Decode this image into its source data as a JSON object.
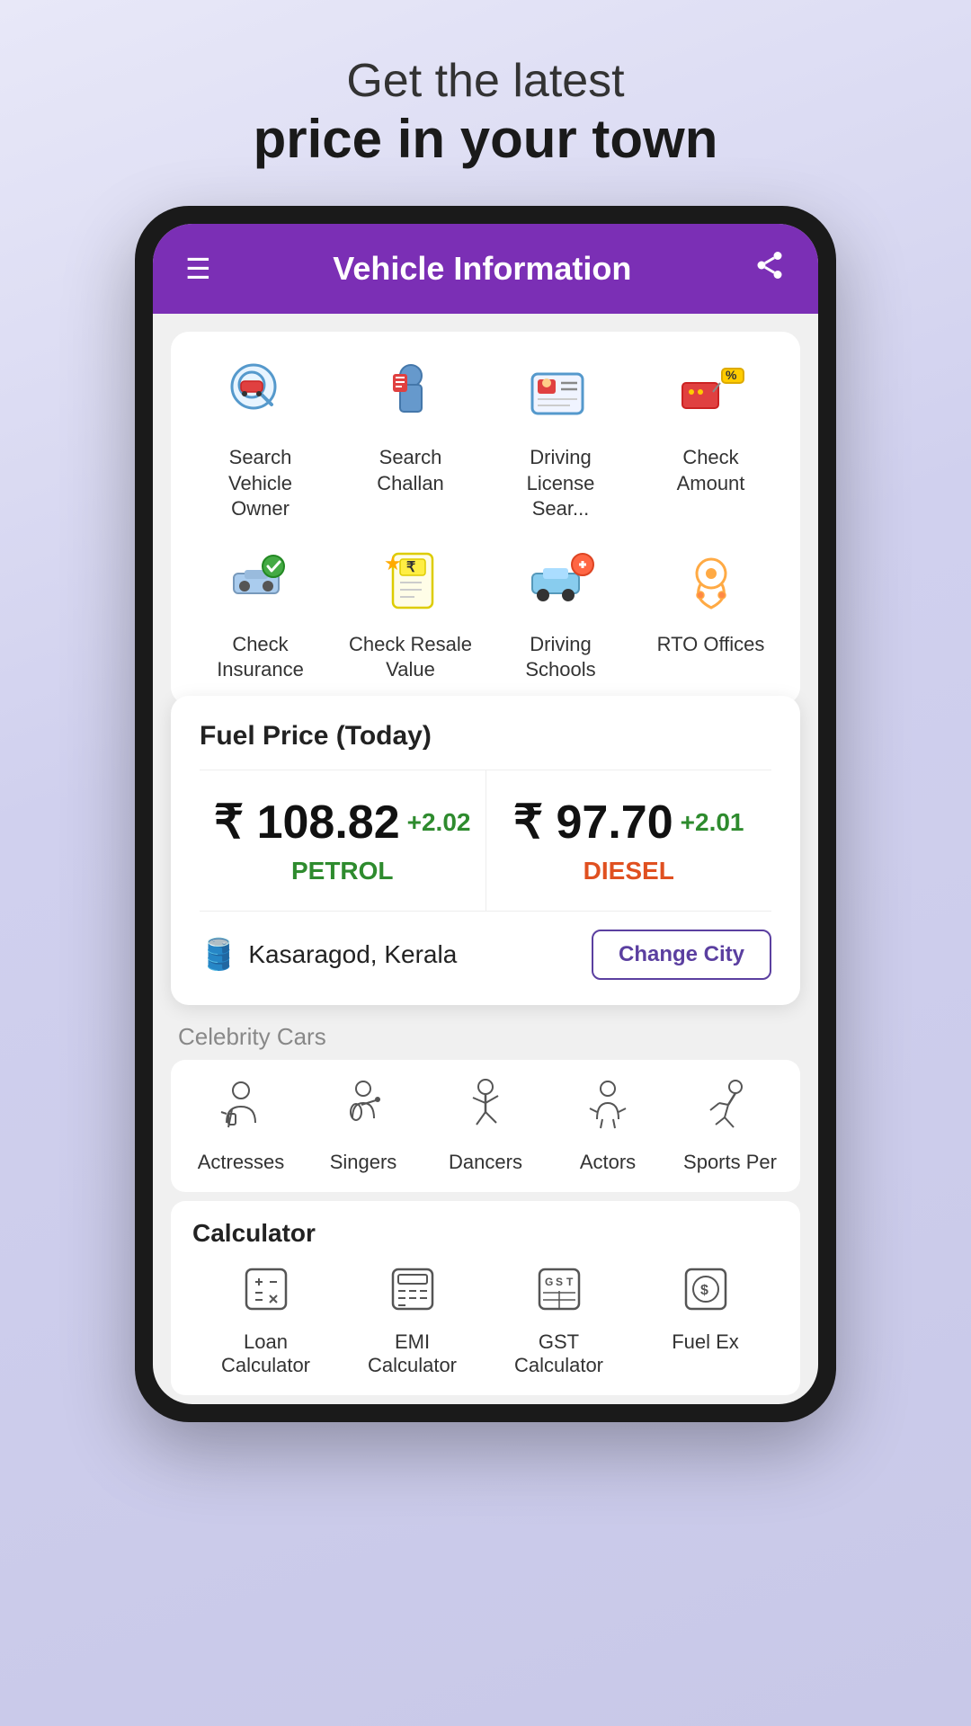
{
  "headline": {
    "line1": "Get the latest",
    "line2": "price in your town"
  },
  "app": {
    "header_title": "Vehicle Information",
    "menu_icon": "☰",
    "share_icon": "⬆"
  },
  "grid": {
    "row1": [
      {
        "id": "search-vehicle-owner",
        "label": "Search Vehicle Owner",
        "icon": "🔍"
      },
      {
        "id": "search-challan",
        "label": "Search Challan",
        "icon": "👮"
      },
      {
        "id": "driving-license",
        "label": "Driving License Sear...",
        "icon": "🪪"
      },
      {
        "id": "check-amount",
        "label": "Check Amount",
        "icon": "🏷️"
      }
    ],
    "row2": [
      {
        "id": "check-insurance",
        "label": "Check Insurance",
        "icon": "🚗"
      },
      {
        "id": "check-resale",
        "label": "Check Resale Value",
        "icon": "🏷️"
      },
      {
        "id": "driving-schools",
        "label": "Driving Schools",
        "icon": "🚙"
      },
      {
        "id": "rto-offices",
        "label": "RTO Offices",
        "icon": "📍"
      }
    ]
  },
  "fuel": {
    "title": "Fuel Price (Today)",
    "petrol": {
      "value": "₹ 108.82",
      "change": "+2.02",
      "label": "PETROL"
    },
    "diesel": {
      "value": "₹ 97.70",
      "change": "+2.01",
      "label": "DIESEL"
    },
    "city": "Kasaragod, Kerala",
    "change_city_btn": "Change City"
  },
  "celebrity": {
    "section_label": "Celebrity Cars",
    "items": [
      {
        "id": "actresses",
        "label": "Actresses",
        "icon": "🎭"
      },
      {
        "id": "singers",
        "label": "Singers",
        "icon": "🎸"
      },
      {
        "id": "dancers",
        "label": "Dancers",
        "icon": "💃"
      },
      {
        "id": "actors",
        "label": "Actors",
        "icon": "🎬"
      },
      {
        "id": "sports-persons",
        "label": "Sports Per",
        "icon": "⛷️"
      }
    ]
  },
  "calculator": {
    "title": "Calculator",
    "items": [
      {
        "id": "loan-calculator",
        "label": "Loan Calculator",
        "icon": "🧮"
      },
      {
        "id": "emi-calculator",
        "label": "EMI Calculator",
        "icon": "📊"
      },
      {
        "id": "gst-calculator",
        "label": "GST Calculator",
        "icon": "💱"
      },
      {
        "id": "fuel-ex",
        "label": "Fuel Ex",
        "icon": "💲"
      }
    ]
  }
}
